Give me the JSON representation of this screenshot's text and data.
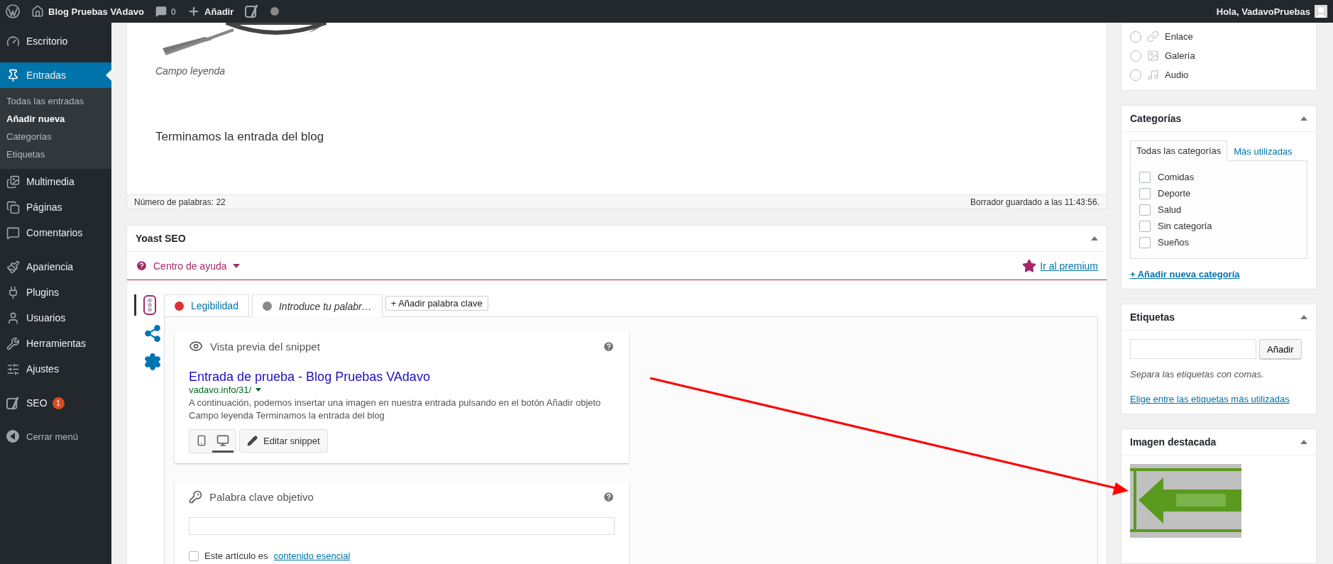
{
  "admin_bar": {
    "site_name": "Blog Pruebas VAdavo",
    "comments_count": "0",
    "new_label": "Añadir",
    "greeting": "Hola, VadavoPruebas"
  },
  "sidebar": {
    "groups": [
      [
        {
          "label": "Escritorio",
          "selected": false
        }
      ],
      [
        {
          "label": "Entradas",
          "selected": true,
          "children": [
            {
              "label": "Todas las entradas",
              "selected": false
            },
            {
              "label": "Añadir nueva",
              "selected": true
            },
            {
              "label": "Categorías",
              "selected": false
            },
            {
              "label": "Etiquetas",
              "selected": false
            }
          ]
        },
        {
          "label": "Multimedia",
          "selected": false
        },
        {
          "label": "Páginas",
          "selected": false
        },
        {
          "label": "Comentarios",
          "selected": false
        }
      ],
      [
        {
          "label": "Apariencia",
          "selected": false
        },
        {
          "label": "Plugins",
          "selected": false
        },
        {
          "label": "Usuarios",
          "selected": false
        },
        {
          "label": "Herramientas",
          "selected": false
        },
        {
          "label": "Ajustes",
          "selected": false
        }
      ],
      [
        {
          "label": "SEO",
          "selected": false,
          "badge": "1"
        }
      ]
    ],
    "collapse_label": "Cerrar menú"
  },
  "editor": {
    "caption": "Campo leyenda",
    "paragraph": "Terminamos la entrada del blog",
    "word_count": "Número de palabras: 22",
    "draft_status": "Borrador guardado a las 11:43:56."
  },
  "yoast": {
    "title": "Yoast SEO",
    "help_label": "Centro de ayuda",
    "premium_label": "Ir al premium",
    "side_tabs": [
      {
        "selected": true
      },
      {
        "selected": false
      },
      {
        "selected": false
      }
    ],
    "tabs": [
      {
        "label": "Legibilidad",
        "color": "#dc3232",
        "selected": false
      },
      {
        "label": "Introduce tu palabr…",
        "color": "#888888",
        "selected": true
      }
    ],
    "add_keyword_label": "+ Añadir palabra clave",
    "snippet": {
      "heading": "Vista previa del snippet",
      "title": "Entrada de prueba - Blog Pruebas VAdavo",
      "url": "vadavo.info/31/",
      "description": "A continuación, podemos insertar una imagen en nuestra entrada pulsando en el botón Añadir objeto Campo leyenda Terminamos la entrada del blog",
      "modes": [
        {
          "selected": false
        },
        {
          "selected": true
        }
      ],
      "edit_label": "Editar snippet"
    },
    "keyword": {
      "heading": "Palabra clave objetivo",
      "cornerstone_text": "Este artículo es",
      "cornerstone_link": "contenido esencial",
      "cornerstone_checked": false
    }
  },
  "format": {
    "options": [
      {
        "label": "Enlace",
        "selected": false
      },
      {
        "label": "Galería",
        "selected": false
      },
      {
        "label": "Audio",
        "selected": false
      }
    ]
  },
  "categories": {
    "title": "Categorías",
    "tabs": [
      {
        "label": "Todas las categorías",
        "selected": true
      },
      {
        "label": "Más utilizadas",
        "selected": false
      }
    ],
    "items": [
      {
        "label": "Comidas",
        "checked": false
      },
      {
        "label": "Deporte",
        "checked": false
      },
      {
        "label": "Salud",
        "checked": false
      },
      {
        "label": "Sin categoría",
        "checked": false
      },
      {
        "label": "Sueños",
        "checked": false
      }
    ],
    "add_link": "+ Añadir nueva categoría"
  },
  "tags": {
    "title": "Etiquetas",
    "button": "Añadir",
    "hint": "Separa las etiquetas con comas.",
    "choose_link": "Elige entre las etiquetas más utilizadas"
  },
  "featured_image": {
    "title": "Imagen destacada"
  }
}
